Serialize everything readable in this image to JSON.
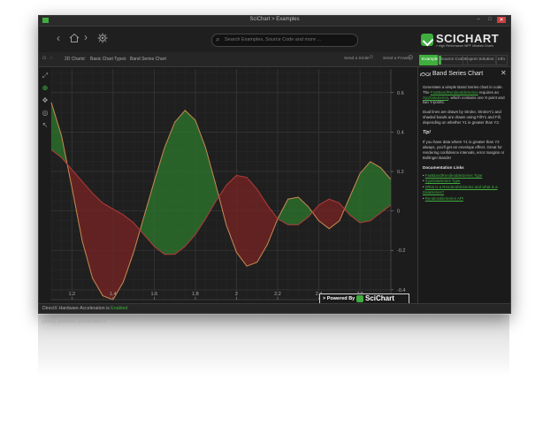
{
  "window": {
    "title": "SciChart > Examples",
    "controls": [
      "–",
      "□",
      "✕"
    ]
  },
  "toolbar": {
    "search_placeholder": "Search Examples, Source Code and more ...",
    "logo_name": "SCICHART",
    "logo_tagline": "» High Performance WPF Ultrafast Charts"
  },
  "breadcrumb": {
    "items": [
      "2D Charts",
      "Basic Chart Types",
      "Band Series Chart"
    ]
  },
  "navbar": {
    "send_smile": "Send a Smile",
    "send_frown": "Send a Frown",
    "tabs": [
      "Example",
      "Source Code",
      "Export Solution",
      "Info"
    ]
  },
  "powered_by": {
    "label": "> Powered By",
    "brand": "SciChart"
  },
  "info": {
    "title": "Band Series Chart",
    "p1_pre": "Generates a simple Band Series chart in code. The ",
    "p1_link": "FastBandRenderableSeries",
    "p1_mid": " requires an ",
    "p1_link2": "XyyDataSeries",
    "p1_post": ", which contains one X-point and two Y-points.",
    "p2": "Dual lines are drawn by Stroke, StrokeY1 and shaded bands are drawn using FillY1 and Fill, depending on whether Y1 is greater than Y2.",
    "tip_head": "Tip!",
    "p3": "If you have data where Y1 is greater than Y2 always, you'll get an envelope effect. Great for rendering confidence intervals, error margins or Bollinger Bands!",
    "links_head": "Documentation Links",
    "links": [
      "FastBandRenderableSeries Type",
      "XyyDataSeries Type",
      "What is a RenderableSeries and what is a DataSeries?",
      "RenderableSeries API"
    ]
  },
  "status": {
    "prefix": "DirectX Hardware Acceleration is ",
    "state": "Enabled"
  },
  "colors": {
    "accent": "#3fae3f",
    "band_up": "#2d7a2d",
    "band_down": "#7a2424",
    "line_y1": "#c98a52",
    "line_y2": "#b33a3a"
  },
  "chart_data": {
    "type": "area",
    "title": "",
    "xlabel": "",
    "ylabel": "",
    "xlim": [
      1.1,
      2.75
    ],
    "ylim": [
      -0.45,
      0.72
    ],
    "x_ticks": [
      "1.2",
      "1.4",
      "1.6",
      "1.8",
      "2",
      "2.2",
      "2.4",
      "2.6"
    ],
    "y_ticks": [
      "0.6",
      "0.4",
      "0.2",
      "0",
      "-0.2",
      "-0.4"
    ],
    "x": [
      1.1,
      1.15,
      1.2,
      1.25,
      1.3,
      1.35,
      1.4,
      1.45,
      1.5,
      1.55,
      1.6,
      1.65,
      1.7,
      1.75,
      1.8,
      1.85,
      1.9,
      1.95,
      2.0,
      2.05,
      2.1,
      2.15,
      2.2,
      2.25,
      2.3,
      2.35,
      2.4,
      2.45,
      2.5,
      2.55,
      2.6,
      2.65,
      2.7,
      2.75
    ],
    "series": [
      {
        "values": [
          0.55,
          0.38,
          0.12,
          -0.15,
          -0.34,
          -0.43,
          -0.45,
          -0.36,
          -0.21,
          -0.03,
          0.15,
          0.32,
          0.45,
          0.51,
          0.46,
          0.32,
          0.13,
          -0.07,
          -0.21,
          -0.28,
          -0.26,
          -0.17,
          -0.04,
          0.06,
          0.07,
          0.02,
          -0.05,
          -0.09,
          -0.05,
          0.07,
          0.19,
          0.25,
          0.22,
          0.16
        ]
      },
      {
        "values": [
          0.31,
          0.27,
          0.21,
          0.15,
          0.09,
          0.04,
          0.01,
          -0.02,
          -0.06,
          -0.12,
          -0.18,
          -0.22,
          -0.22,
          -0.18,
          -0.12,
          -0.04,
          0.05,
          0.13,
          0.18,
          0.17,
          0.11,
          0.03,
          -0.04,
          -0.07,
          -0.07,
          -0.03,
          0.03,
          0.06,
          0.04,
          -0.02,
          -0.06,
          -0.05,
          -0.01,
          0.03
        ]
      }
    ]
  }
}
